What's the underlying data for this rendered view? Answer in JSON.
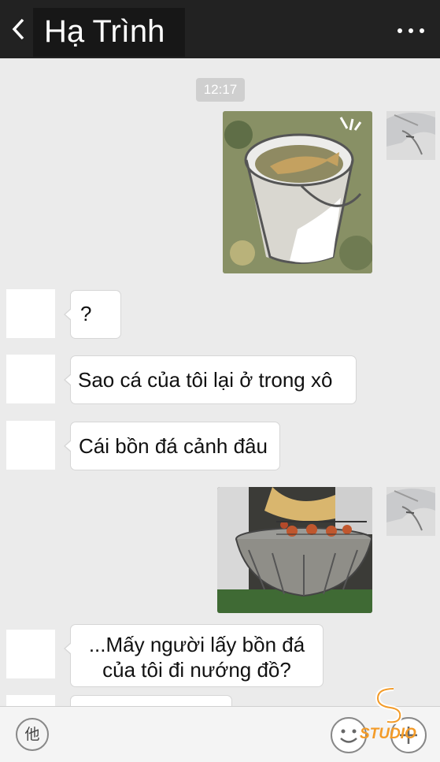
{
  "header": {
    "title": "Hạ Trình",
    "back_icon": "back-chevron-icon",
    "more_icon": "more-dots-icon"
  },
  "chat": {
    "timestamp": "12:17",
    "messages": [
      {
        "side": "right",
        "type": "image",
        "content": "bucket-with-fish-picture"
      },
      {
        "side": "left",
        "type": "text",
        "text": "?"
      },
      {
        "side": "left",
        "type": "text",
        "text": "Sao cá của tôi lại ở trong xô"
      },
      {
        "side": "left",
        "type": "text",
        "text": "Cái bồn đá cảnh đâu"
      },
      {
        "side": "right",
        "type": "image",
        "content": "stone-basin-grill-picture"
      },
      {
        "side": "left",
        "type": "text",
        "line1": "...Mấy người lấy bồn đá",
        "line2": "của tôi đi nướng đồ?"
      },
      {
        "side": "left",
        "type": "text",
        "text": ""
      }
    ]
  },
  "input_bar": {
    "voice_label": "他",
    "emoji_icon": "emoji-face-icon",
    "plus_icon": "plus-icon"
  },
  "watermark": {
    "text": "STUDIO",
    "logo": "s3-logo"
  },
  "colors": {
    "header_bg": "#222222",
    "chat_bg": "#ebebeb",
    "bubble_bg": "#ffffff",
    "watermark": "#f39b28"
  }
}
